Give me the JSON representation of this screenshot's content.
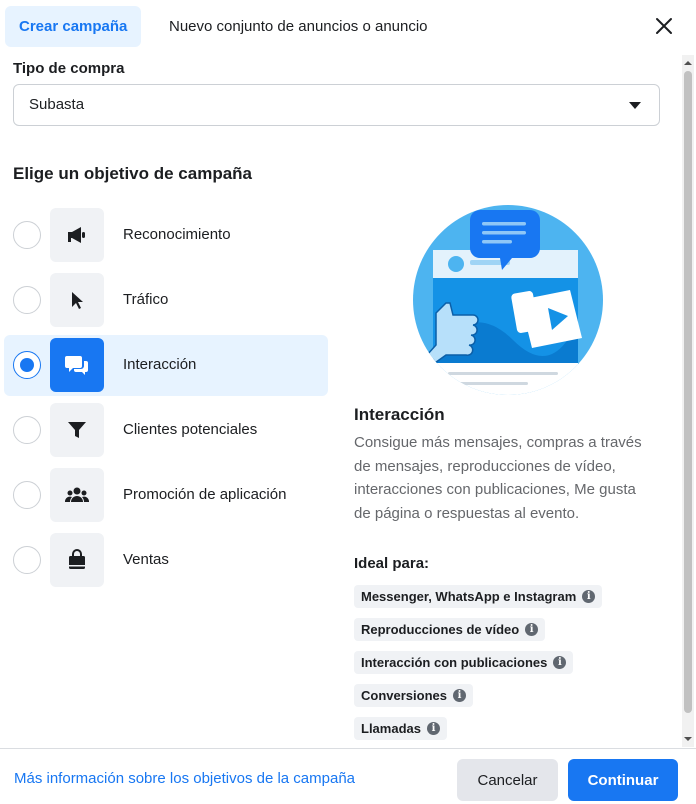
{
  "header": {
    "tab_active": "Crear campaña",
    "tab_inactive": "Nuevo conjunto de anuncios o anuncio"
  },
  "buy_type": {
    "label": "Tipo de compra",
    "value": "Subasta"
  },
  "objectives_section": {
    "title": "Elige un objetivo de campaña",
    "items": [
      {
        "label": "Reconocimiento",
        "icon": "megaphone-icon",
        "selected": false
      },
      {
        "label": "Tráfico",
        "icon": "cursor-icon",
        "selected": false
      },
      {
        "label": "Interacción",
        "icon": "chat-bubbles-icon",
        "selected": true
      },
      {
        "label": "Clientes potenciales",
        "icon": "filter-icon",
        "selected": false
      },
      {
        "label": "Promoción de aplicación",
        "icon": "people-icon",
        "selected": false
      },
      {
        "label": "Ventas",
        "icon": "shopping-bag-icon",
        "selected": false
      }
    ]
  },
  "detail": {
    "title": "Interacción",
    "description": "Consigue más mensajes, compras a través de mensajes, reproducciones de vídeo, interacciones con publicaciones, Me gusta de página o respuestas al evento.",
    "ideal_label": "Ideal para:",
    "chips": [
      "Messenger, WhatsApp e Instagram",
      "Reproducciones de vídeo",
      "Interacción con publicaciones",
      "Conversiones",
      "Llamadas"
    ]
  },
  "footer": {
    "link": "Más información sobre los objetivos de la campaña",
    "cancel": "Cancelar",
    "continue": "Continuar"
  },
  "colors": {
    "accent": "#1877f2",
    "selected_bg": "#e7f3ff",
    "icon_bg": "#f0f2f5"
  }
}
